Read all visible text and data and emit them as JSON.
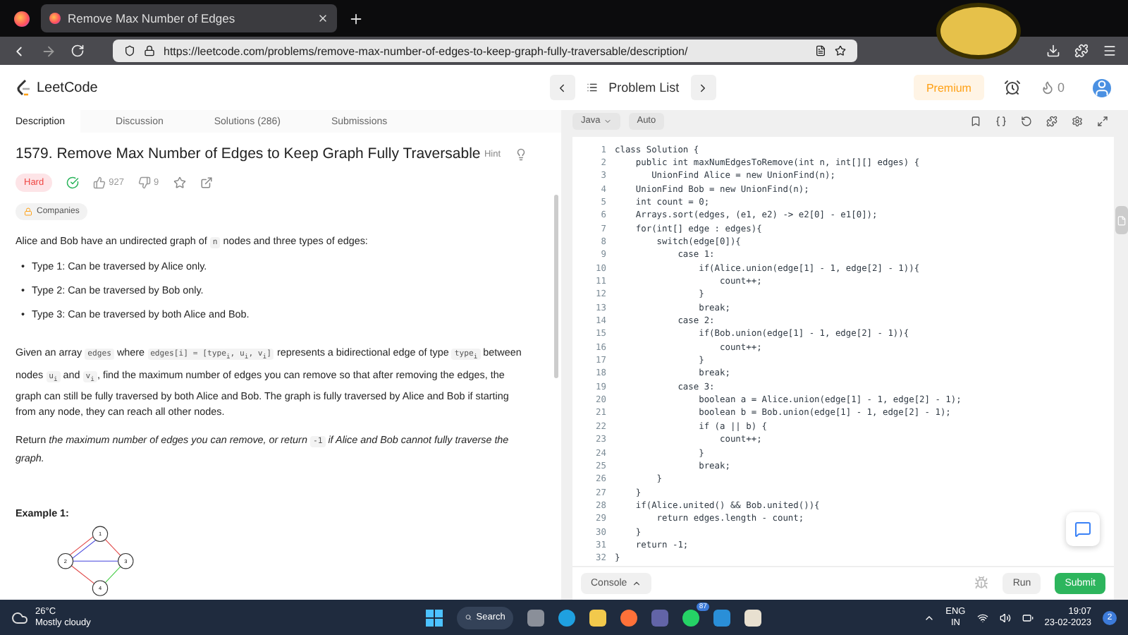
{
  "browser": {
    "tab_title": "Remove Max Number of Edges",
    "url": "https://leetcode.com/problems/remove-max-number-of-edges-to-keep-graph-fully-traversable/description/"
  },
  "header": {
    "logo": "LeetCode",
    "problem_list": "Problem List",
    "premium": "Premium",
    "streak": "0"
  },
  "tabs": [
    {
      "label": "Description",
      "selected": true
    },
    {
      "label": "Discussion",
      "selected": false
    },
    {
      "label": "Solutions (286)",
      "selected": false
    },
    {
      "label": "Submissions",
      "selected": false
    }
  ],
  "editor_toolbar": {
    "language": "Java",
    "mode": "Auto"
  },
  "problem": {
    "title": "1579. Remove Max Number of Edges to Keep Graph Fully Traversable",
    "hint": "Hint",
    "difficulty": "Hard",
    "solved": true,
    "likes": "927",
    "dislikes": "9",
    "companies": "Companies",
    "paragraphs": [
      [
        {
          "kind": "text",
          "text": "Alice and Bob have an undirected graph of "
        },
        {
          "kind": "code",
          "text": "n"
        },
        {
          "kind": "text",
          "text": " nodes and three types of edges:"
        }
      ]
    ],
    "bullet_marker": "•",
    "bullets": [
      "Type 1: Can be traversed by Alice only.",
      "Type 2: Can be traversed by Bob only.",
      "Type 3: Can be traversed by both Alice and Bob."
    ],
    "details": [
      [
        {
          "kind": "text",
          "text": "Given an array "
        },
        {
          "kind": "code",
          "text": "edges"
        },
        {
          "kind": "text",
          "text": " where "
        },
        {
          "kind": "code",
          "text": "edges[i] = [type$_{i}$, u$_{i}$, v$_{i}$]"
        },
        {
          "kind": "text",
          "text": " represents a bidirectional edge of type "
        },
        {
          "kind": "code",
          "text": "type$_{i}$"
        },
        {
          "kind": "text",
          "text": " between nodes "
        },
        {
          "kind": "code",
          "text": "u$_{i}$"
        },
        {
          "kind": "text",
          "text": " and "
        },
        {
          "kind": "code",
          "text": "v$_{i}$"
        },
        {
          "kind": "text",
          "text": ", find the maximum number of edges you can remove so that after removing the edges, the graph can still be fully traversed by both Alice and Bob. The graph is fully traversed by Alice and Bob if starting from any node, they can reach all other nodes."
        }
      ],
      [
        {
          "kind": "text",
          "text": "Return "
        },
        {
          "kind": "italic",
          "text": "the maximum number of edges you can remove, or return "
        },
        {
          "kind": "code",
          "text": "-1"
        },
        {
          "kind": "italic",
          "text": " if Alice and Bob cannot fully traverse the graph."
        }
      ]
    ],
    "example_title": "Example 1:",
    "graph_nodes": [
      "1",
      "2",
      "3",
      "4"
    ]
  },
  "code": [
    "class Solution {",
    "    public int maxNumEdgesToRemove(int n, int[][] edges) {",
    "       UnionFind Alice = new UnionFind(n);",
    "    UnionFind Bob = new UnionFind(n);",
    "    int count = 0;",
    "    Arrays.sort(edges, (e1, e2) -> e2[0] - e1[0]);",
    "    for(int[] edge : edges){",
    "        switch(edge[0]){",
    "            case 1:",
    "                if(Alice.union(edge[1] - 1, edge[2] - 1)){",
    "                    count++;",
    "                }",
    "                break;",
    "            case 2:",
    "                if(Bob.union(edge[1] - 1, edge[2] - 1)){",
    "                    count++;",
    "                }",
    "                break;",
    "            case 3:",
    "                boolean a = Alice.union(edge[1] - 1, edge[2] - 1);",
    "                boolean b = Bob.union(edge[1] - 1, edge[2] - 1);",
    "                if (a || b) {",
    "                    count++;",
    "                }",
    "                break;",
    "        }",
    "    }",
    "    if(Alice.united() && Bob.united()){",
    "        return edges.length - count;",
    "    }",
    "    return -1;",
    "}"
  ],
  "line_numbers": [
    "1",
    "2",
    "3",
    "4",
    "5",
    "6",
    "7",
    "8",
    "9",
    "10",
    "11",
    "12",
    "13",
    "14",
    "15",
    "16",
    "17",
    "18",
    "19",
    "20",
    "21",
    "22",
    "23",
    "24",
    "25",
    "26",
    "27",
    "28",
    "29",
    "30",
    "31",
    "32"
  ],
  "console": {
    "console": "Console",
    "run": "Run",
    "submit": "Submit"
  },
  "taskbar": {
    "temperature": "26°C",
    "weather": "Mostly cloudy",
    "search": "Search",
    "whatsapp_badge": "87",
    "language": "ENG",
    "region": "IN",
    "time": "19:07",
    "date": "23-02-2023",
    "notifications": "2"
  }
}
